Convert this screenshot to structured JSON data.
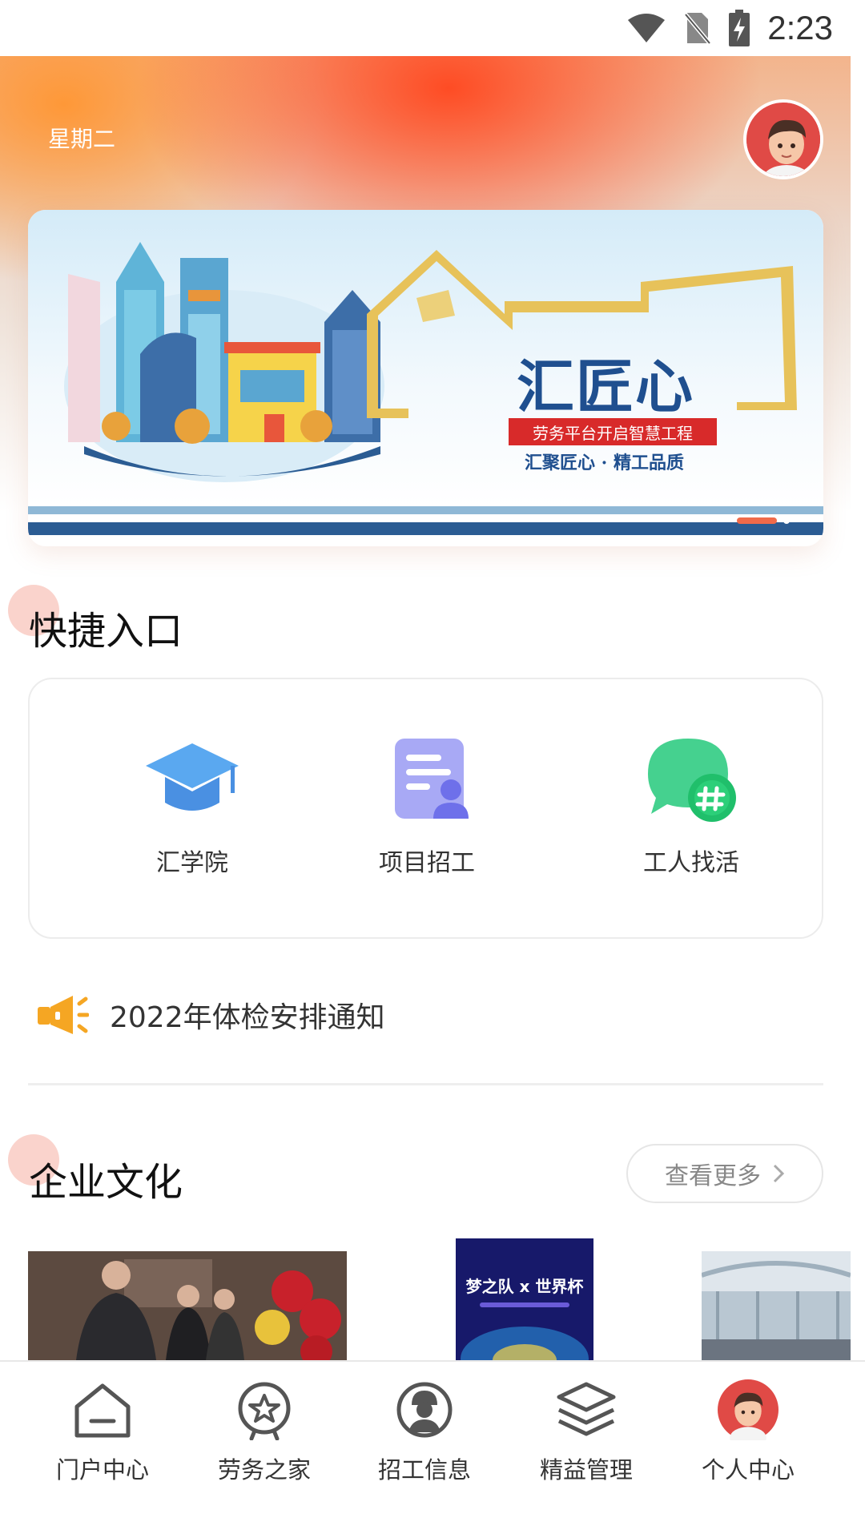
{
  "status_bar": {
    "time": "2:23"
  },
  "header": {
    "weekday": "星期二"
  },
  "banner": {
    "brand_title": "汇匠心",
    "brand_subtitle": "劳务平台开启智慧工程",
    "brand_slogan": "汇聚匠心 · 精工品质"
  },
  "quick_entry": {
    "title": "快捷入口",
    "items": [
      {
        "label": "汇学院",
        "icon": "graduation-cap-icon"
      },
      {
        "label": "项目招工",
        "icon": "document-user-icon"
      },
      {
        "label": "工人找活",
        "icon": "chat-hash-icon"
      }
    ]
  },
  "notice": {
    "text": "2022年体检安排通知",
    "icon": "megaphone-icon"
  },
  "culture": {
    "title": "企业文化",
    "more_label": "查看更多",
    "poster_title": "梦之队 x 世界杯"
  },
  "bottom_nav": {
    "items": [
      {
        "label": "门户中心",
        "icon": "home-icon"
      },
      {
        "label": "劳务之家",
        "icon": "star-badge-icon"
      },
      {
        "label": "招工信息",
        "icon": "worker-icon"
      },
      {
        "label": "精益管理",
        "icon": "layers-icon"
      },
      {
        "label": "个人中心",
        "icon": "avatar-icon"
      }
    ]
  },
  "colors": {
    "accent_orange": "#ff5a2a",
    "brand_blue": "#1f4f8f",
    "icon_blue": "#4a90e2",
    "icon_purple": "#7b7ff0",
    "icon_green": "#2ecf7a"
  }
}
